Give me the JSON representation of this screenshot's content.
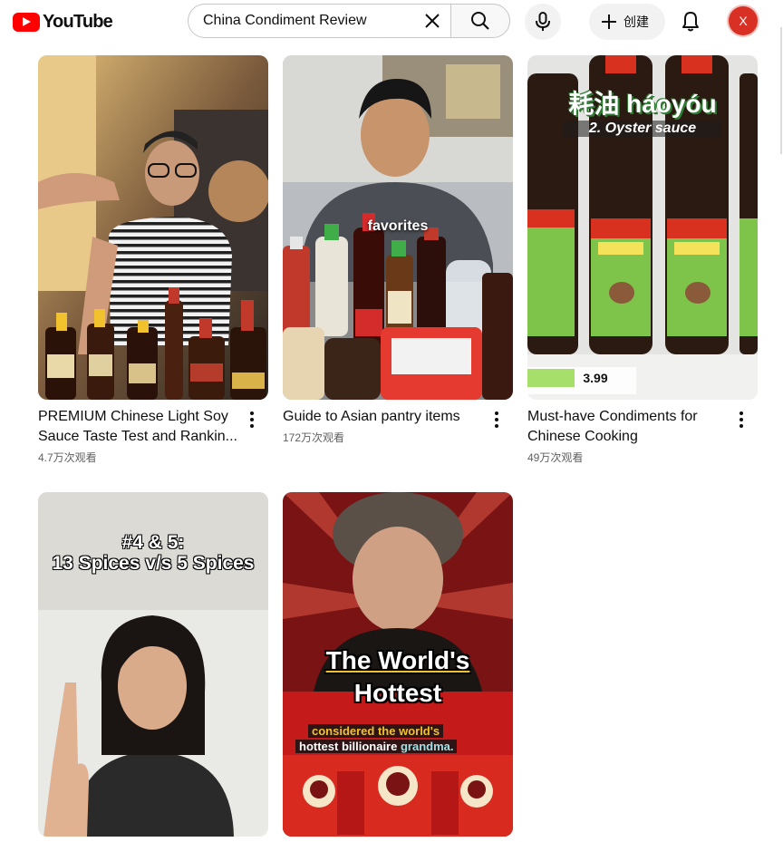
{
  "header": {
    "logo_text": "YouTube",
    "search_value": "China Condiment Review",
    "create_label": "创建",
    "avatar_letter": "X"
  },
  "colors": {
    "brand": "#ff0000",
    "avatar": "#d93025",
    "secondary_text": "#606060"
  },
  "videos": [
    {
      "title": "PREMIUM Chinese Light Soy Sauce Taste Test and Rankin...",
      "views": "4.7万次观看"
    },
    {
      "title": "Guide to Asian pantry items",
      "views": "172万次观看",
      "overlay": "favorites"
    },
    {
      "title": "Must-have Condiments for Chinese Cooking",
      "views": "49万次观看",
      "overlay_cn": "耗油 háoyóu",
      "overlay_en": "2. Oyster sauce",
      "price": "3.99"
    },
    {
      "overlay_line1": "#4 & 5:",
      "overlay_line2": "13 Spices v/s 5 Spices"
    },
    {
      "overlay_line1": "The World's",
      "overlay_line2": "Hottest",
      "caption_line1": "considered the world's",
      "caption_line2a": "hottest billionaire ",
      "caption_line2b": "grandma."
    }
  ],
  "icons": [
    "youtube-logo-icon",
    "clear-icon",
    "search-icon",
    "mic-icon",
    "plus-icon",
    "bell-icon",
    "more-vert-icon"
  ]
}
